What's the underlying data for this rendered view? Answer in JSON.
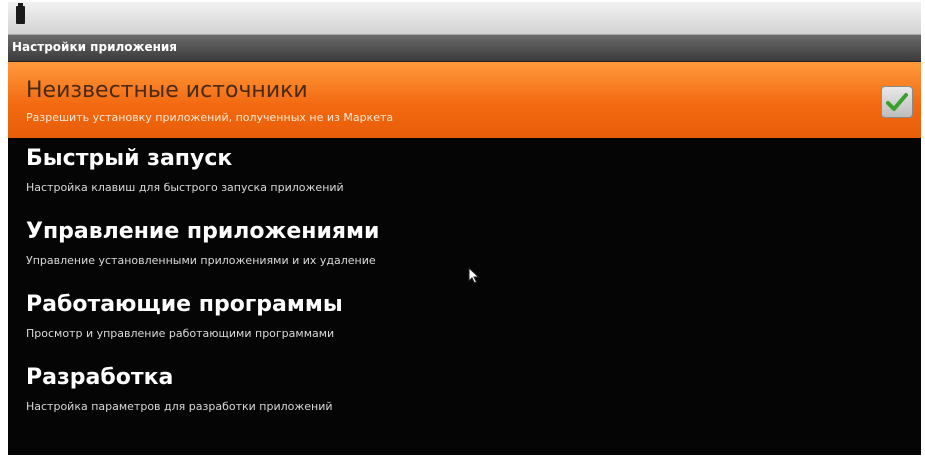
{
  "header": {
    "title": "Настройки приложения"
  },
  "settings": {
    "items": [
      {
        "title": "Неизвестные источники",
        "subtitle": "Разрешить установку приложений, полученных не из Маркета",
        "checked": true,
        "selected": true
      },
      {
        "title": "Быстрый запуск",
        "subtitle": "Настройка клавиш для быстрого запуска приложений"
      },
      {
        "title": "Управление приложениями",
        "subtitle": "Управление установленными приложениями и их удаление"
      },
      {
        "title": "Работающие программы",
        "subtitle": "Просмотр и управление работающими программами"
      },
      {
        "title": "Разработка",
        "subtitle": "Настройка параметров для разработки приложений"
      }
    ]
  },
  "icons": {
    "status": "battery-icon",
    "checkbox": "check-icon",
    "pointer": "mouse-pointer-icon"
  },
  "colors": {
    "accent": "#f36a12",
    "check": "#3aa02c",
    "background": "#050505"
  }
}
